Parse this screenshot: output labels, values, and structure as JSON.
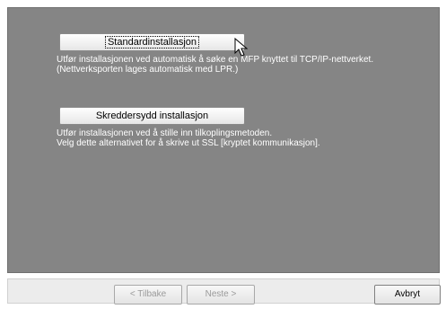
{
  "options": {
    "standard": {
      "button_label": "Standardinstallasjon",
      "description_lines": [
        "Utfør installasjonen ved automatisk å søke en MFP knyttet til TCP/IP-nettverket.",
        "(Nettverksporten lages automatisk med LPR.)"
      ]
    },
    "custom": {
      "button_label": "Skreddersydd installasjon",
      "description_lines": [
        "Utfør installasjonen ved å stille inn tilkoplingsmetoden.",
        "Velg dette alternativet for å skrive ut SSL [kryptet kommunikasjon]."
      ]
    }
  },
  "footer": {
    "back_label": "< Tilbake",
    "next_label": "Neste >",
    "cancel_label": "Avbryt"
  },
  "colors": {
    "panel_background": "#858585",
    "description_text": "#ffffff",
    "disabled_text": "#9a9a9a"
  },
  "icons": {
    "cursor": "mouse-pointer-icon"
  }
}
